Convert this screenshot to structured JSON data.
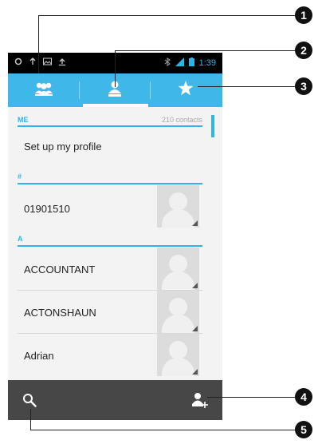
{
  "status_bar": {
    "time": "1:39",
    "icons": [
      "sync-icon",
      "signal-icon",
      "image-icon",
      "upload-icon",
      "bluetooth-icon",
      "cell-signal-icon",
      "battery-icon"
    ]
  },
  "tabs": [
    {
      "name": "groups",
      "icon": "groups-icon"
    },
    {
      "name": "all-contacts",
      "icon": "contact-icon",
      "selected": true
    },
    {
      "name": "favorites",
      "icon": "star-icon"
    }
  ],
  "sections": {
    "me": "ME",
    "hash": "#",
    "a": "A"
  },
  "contacts_count": "210 contacts",
  "profile_row": "Set up my profile",
  "contacts": [
    {
      "label": "01901510"
    },
    {
      "label": "ACCOUNTANT"
    },
    {
      "label": "ACTONSHAUN"
    },
    {
      "label": "Adrian"
    }
  ],
  "bottom_bar": {
    "search_icon": "search-icon",
    "add_contact_icon": "add-contact-icon"
  },
  "callouts": [
    "1",
    "2",
    "3",
    "4",
    "5"
  ],
  "colors": {
    "accent": "#3fb7e8",
    "bottom_bar": "#474747",
    "status_bar": "#000000"
  }
}
